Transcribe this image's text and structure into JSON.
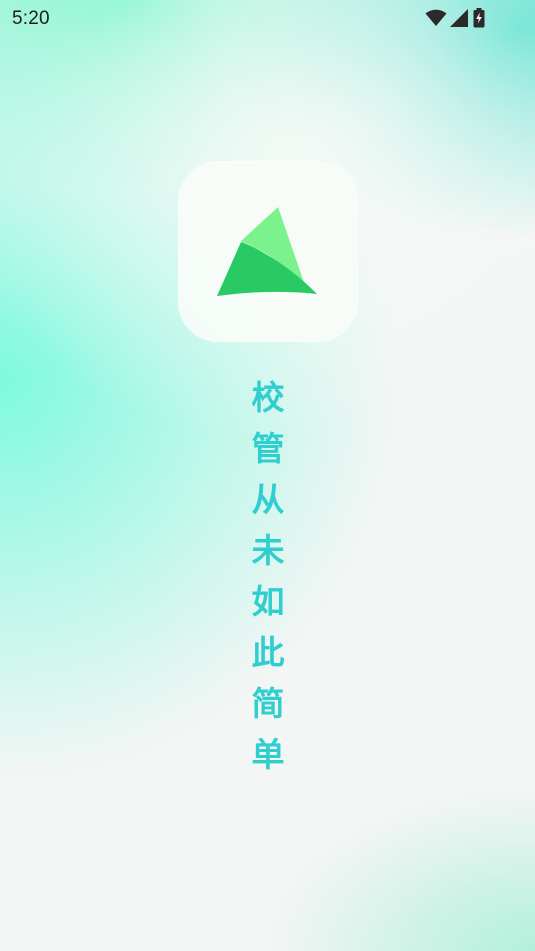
{
  "status_bar": {
    "time": "5:20",
    "icons": [
      "wifi-icon",
      "cellular-signal-icon",
      "battery-charging-icon"
    ]
  },
  "app": {
    "logo_icon": "sail-logo-icon",
    "slogan_chars": [
      "校",
      "管",
      "从",
      "未",
      "如",
      "此",
      "简",
      "单"
    ]
  },
  "colors": {
    "slogan": "#2fcfcf",
    "logo_dark": "#29c964",
    "logo_light": "#7cf28e",
    "status_icons": "#2b2b2b"
  }
}
